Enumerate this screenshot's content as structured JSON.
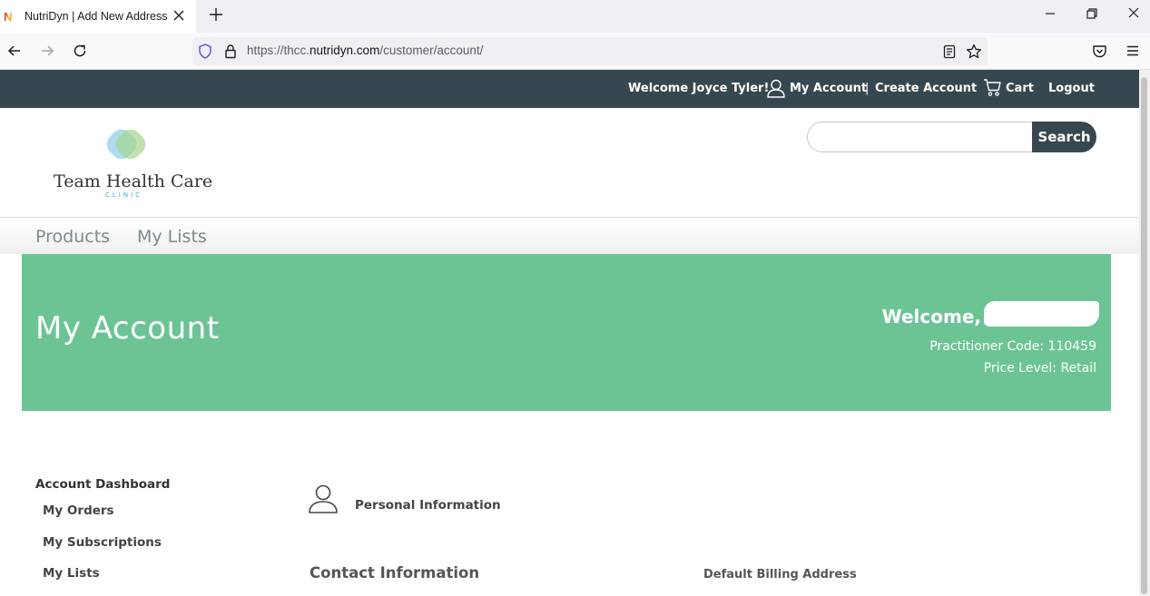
{
  "browser": {
    "tab_title": "NutriDyn | Add New Address",
    "favicon_letter": "N",
    "url_prefix": "https://thcc.",
    "url_domain": "nutridyn.com",
    "url_path": "/customer/account/"
  },
  "top_bar": {
    "welcome": "Welcome Joyce Tyler!",
    "my_account": "My Account",
    "separator": "|",
    "create_account": "Create Account",
    "cart": "Cart",
    "logout": "Logout"
  },
  "logo": {
    "name": "Team Health Care",
    "sub": "CLINIC"
  },
  "search": {
    "placeholder": "",
    "button": "Search"
  },
  "menu": {
    "products": "Products",
    "my_lists": "My Lists"
  },
  "banner": {
    "title": "My Account",
    "welcome": "Welcome,",
    "practitioner_label": "Practitioner Code: ",
    "practitioner_code": "110459",
    "price_label": "Price Level: ",
    "price_level": "Retail",
    "color": "#6cc495"
  },
  "sidebar": {
    "title": "Account Dashboard",
    "items": [
      "My Orders",
      "My Subscriptions",
      "My Lists"
    ]
  },
  "main": {
    "personal_information": "Personal Information",
    "contact_information": "Contact Information",
    "default_billing": "Default Billing Address"
  },
  "colors": {
    "header_dark": "#37474f",
    "accent_green": "#6cc495"
  }
}
